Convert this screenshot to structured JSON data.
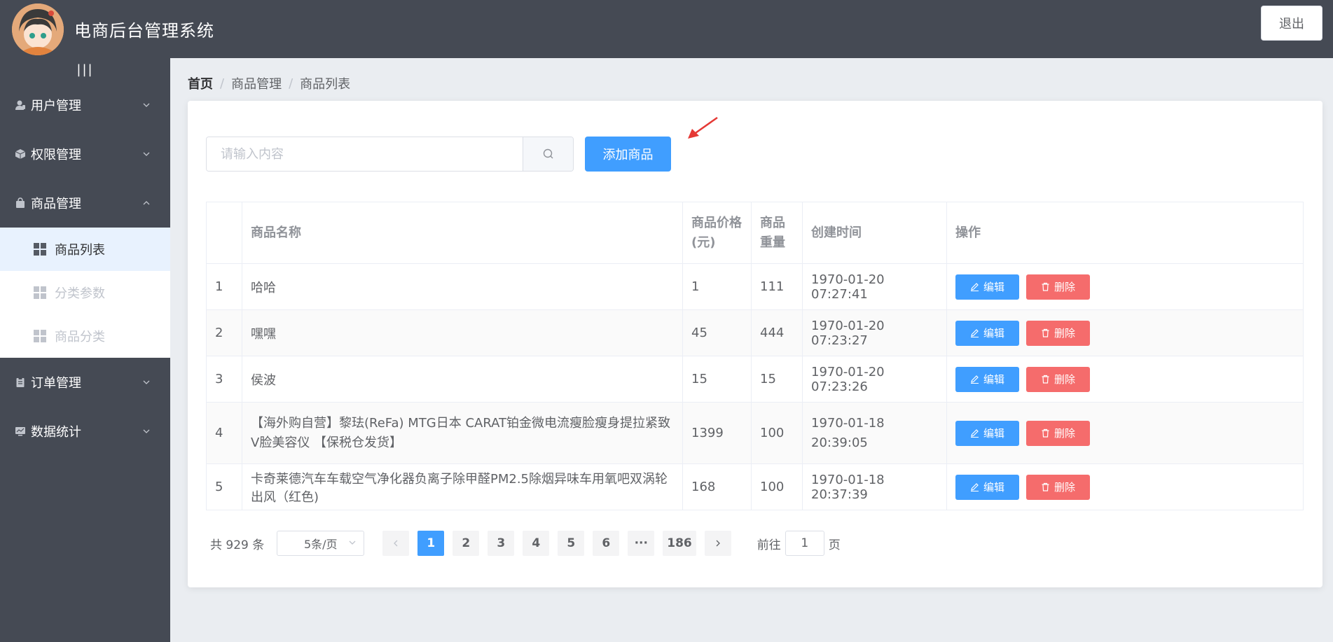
{
  "header": {
    "title": "电商后台管理系统",
    "logout_label": "退出"
  },
  "sidebar": {
    "toggle": "|||",
    "items": [
      {
        "label": "用户管理",
        "icon": "user-icon"
      },
      {
        "label": "权限管理",
        "icon": "box-icon"
      },
      {
        "label": "商品管理",
        "icon": "bag-icon",
        "expanded": true
      },
      {
        "label": "订单管理",
        "icon": "clipboard-icon"
      },
      {
        "label": "数据统计",
        "icon": "monitor-icon"
      }
    ],
    "sub_items": [
      {
        "label": "商品列表",
        "active": true
      },
      {
        "label": "分类参数"
      },
      {
        "label": "商品分类"
      }
    ]
  },
  "breadcrumb": [
    "首页",
    "商品管理",
    "商品列表"
  ],
  "search": {
    "placeholder": "请输入内容",
    "value": ""
  },
  "add_button": "添加商品",
  "table": {
    "headers": [
      "",
      "商品名称",
      "商品价格(元)",
      "商品重量",
      "创建时间",
      "操作"
    ],
    "edit_label": "编辑",
    "delete_label": "删除",
    "rows": [
      {
        "index": "1",
        "name": "哈哈",
        "price": "1",
        "weight": "111",
        "time": "1970-01-20 07:27:41"
      },
      {
        "index": "2",
        "name": "嘿嘿",
        "price": "45",
        "weight": "444",
        "time": "1970-01-20 07:23:27"
      },
      {
        "index": "3",
        "name": "侯波",
        "price": "15",
        "weight": "15",
        "time": "1970-01-20 07:23:26"
      },
      {
        "index": "4",
        "name": "【海外购自营】黎珐(ReFa) MTG日本 CARAT铂金微电流瘦脸瘦身提拉紧致V脸美容仪 【保税仓发货】",
        "price": "1399",
        "weight": "100",
        "time": "1970-01-18 20:39:05"
      },
      {
        "index": "5",
        "name": "卡奇莱德汽车车载空气净化器负离子除甲醛PM2.5除烟异味车用氧吧双涡轮出风（红色)",
        "price": "168",
        "weight": "100",
        "time": "1970-01-18 20:37:39"
      }
    ]
  },
  "pagination": {
    "total": "共 929 条",
    "page_size": "5条/页",
    "pages": [
      "1",
      "2",
      "3",
      "4",
      "5",
      "6",
      "···",
      "186"
    ],
    "current": "1",
    "goto_prefix": "前往",
    "goto_value": "1",
    "goto_suffix": "页"
  },
  "colors": {
    "primary": "#409eff",
    "danger": "#f56c6c",
    "header_bg": "#454a54"
  }
}
